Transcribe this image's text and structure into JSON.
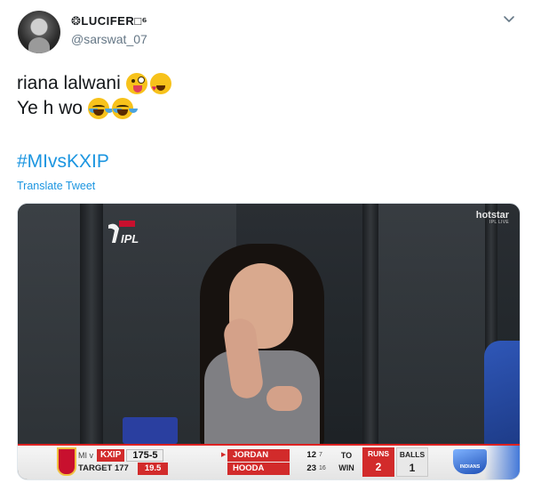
{
  "header": {
    "display_name": "❂LUCIFER□⁶",
    "handle": "@sarswat_07",
    "chevron_icon": "chevron-down-icon",
    "avatar_icon": "avatar"
  },
  "tweet": {
    "line1": "riana lalwani",
    "line1_emojis": [
      "zany-face-emoji",
      "heart-eyes-emoji"
    ],
    "line2": "Ye h wo",
    "line2_emojis": [
      "tears-of-joy-emoji",
      "tears-of-joy-emoji"
    ],
    "hashtag": "#MIvsKXIP",
    "translate": "Translate Tweet"
  },
  "media": {
    "broadcaster": "hotstar",
    "broadcaster_sub": "IPL LIVE",
    "league_logo": "IPL",
    "scorebar": {
      "vs_label": "MI v",
      "team": "KXIP",
      "score": "175-5",
      "target_label": "TARGET 177",
      "overs": "19.5",
      "batsmen": [
        {
          "name": "JORDAN",
          "runs": "12",
          "balls": "7"
        },
        {
          "name": "HOODA",
          "runs": "23",
          "balls": "16"
        }
      ],
      "to_win_label": "TO\nWIN",
      "to_label": "TO",
      "win_label": "WIN",
      "runs_label": "RUNS",
      "runs_value": "2",
      "balls_label": "BALLS",
      "balls_value": "1",
      "mi_logo": "INDIANS"
    }
  },
  "colors": {
    "link_blue": "#1b95e0",
    "text": "#14171a",
    "muted": "#657786",
    "kxip_red": "#d22b2b"
  }
}
